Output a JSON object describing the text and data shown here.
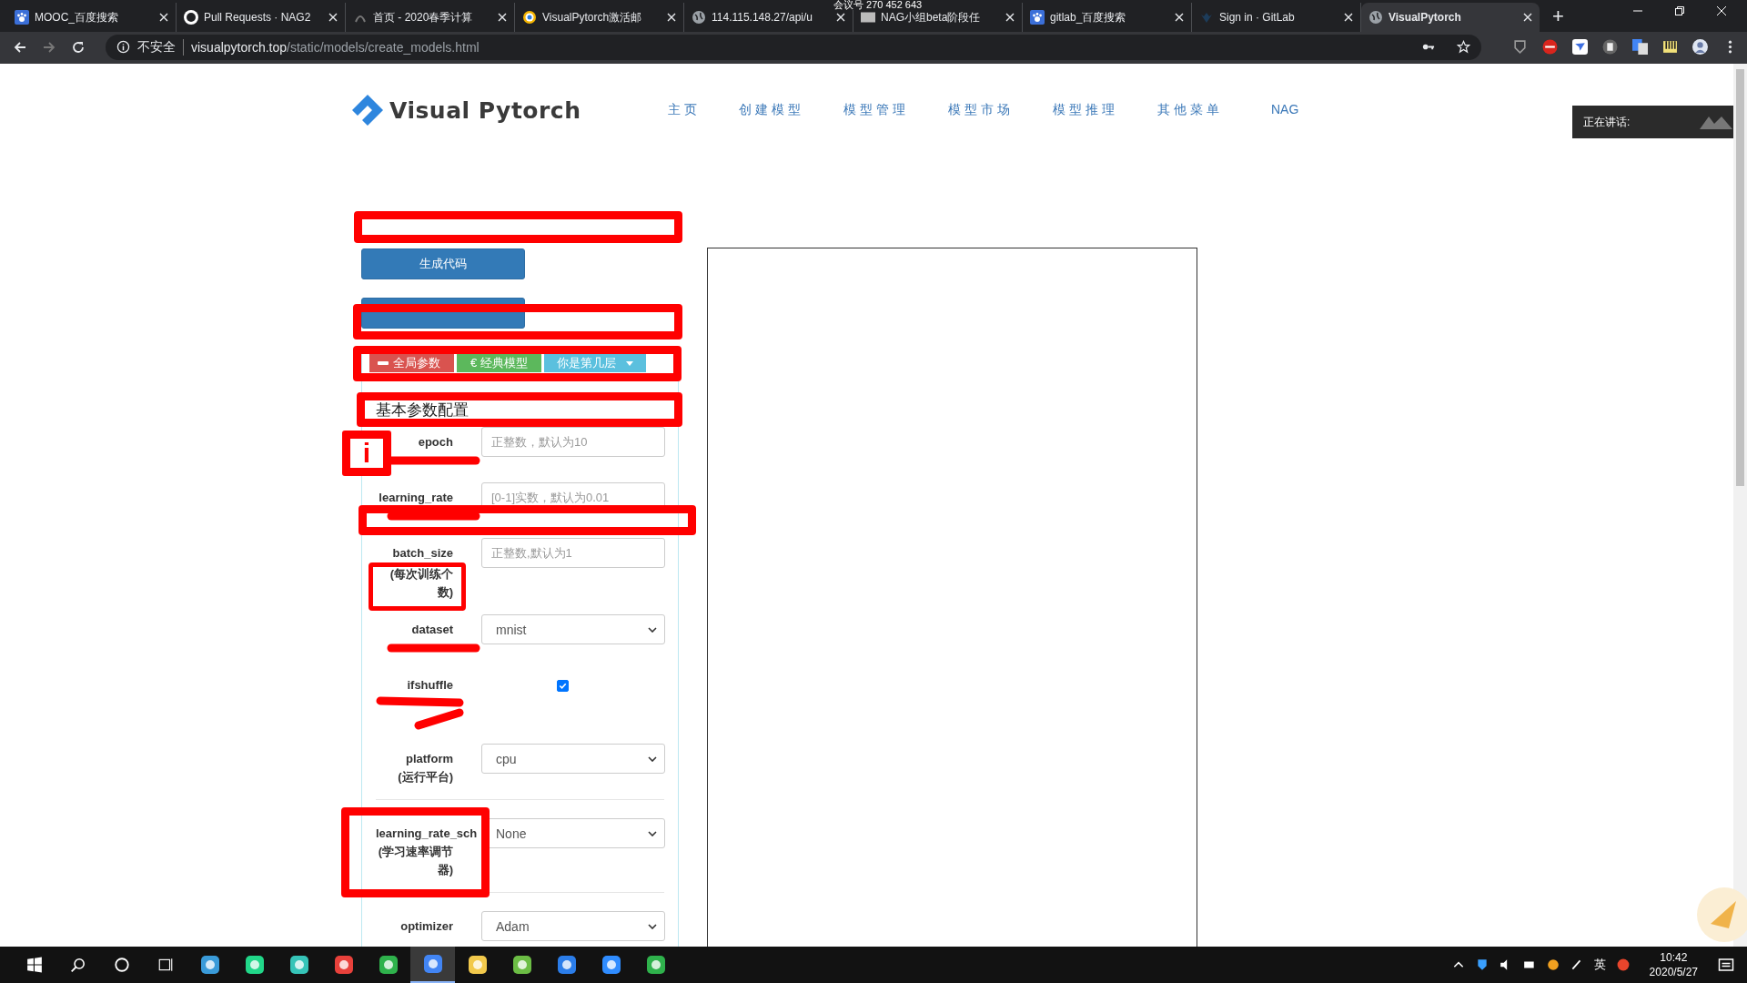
{
  "browser": {
    "tabs": [
      {
        "title": "MOOC_百度搜索",
        "selected": false
      },
      {
        "title": "Pull Requests · NAG2",
        "selected": false
      },
      {
        "title": "首页 - 2020春季计算",
        "selected": false
      },
      {
        "title": "VisualPytorch激活邮",
        "selected": false
      },
      {
        "title": "114.115.148.27/api/u",
        "selected": false
      },
      {
        "title": "NAG小组beta阶段任",
        "selected": false
      },
      {
        "title": "gitlab_百度搜索",
        "selected": false
      },
      {
        "title": "Sign in · GitLab",
        "selected": false
      },
      {
        "title": "VisualPytorch",
        "selected": true
      }
    ],
    "new_tab": "+",
    "meeting_badge": "会议号 270 452 643",
    "address": {
      "security": "不安全",
      "url": "**visualpytorch.top**/static/models/create_models.html"
    }
  },
  "navbar": {
    "brand": "Visual Pytorch",
    "items": [
      {
        "label": "主页"
      },
      {
        "label": "创建模型"
      },
      {
        "label": "模型管理"
      },
      {
        "label": "模型市场"
      },
      {
        "label": "模型推理"
      },
      {
        "label": "其他菜单"
      },
      {
        "label": "NAG"
      }
    ]
  },
  "speaking": {
    "label": "正在讲话:"
  },
  "form": {
    "buttons": [
      {
        "label": "生成代码",
        "boxed": false
      },
      {
        "boxed": true
      }
    ],
    "button_group": {
      "boxed": true,
      "items": [
        {
          "label": "全局参数",
          "color": "#d9534f",
          "kind": "minus"
        },
        {
          "label": "€ 经典模型",
          "color": "#5cb85c",
          "kind": "plain"
        },
        {
          "label": "你是第几层",
          "color": "#5bc0de",
          "kind": "dropdown"
        }
      ]
    },
    "heading": {
      "text": "基本参数配置",
      "boxed": true
    },
    "fields": [
      {
        "label": "epoch",
        "kind": "input",
        "placeholder": "正整数，默认为10",
        "scribbled": true,
        "info_mark": "i"
      },
      {
        "label": "learning_rate",
        "kind": "input",
        "placeholder": "[0-1]实数，默认为0.01",
        "scribbled": true,
        "row_boxed": true
      },
      {
        "label": "batch_size",
        "sublabel": "(每次训练个数)",
        "sublabel_boxed": true,
        "kind": "input",
        "placeholder": "正整数,默认为1"
      },
      {
        "label": "dataset",
        "kind": "select",
        "value": "mnist",
        "scribbled": true
      },
      {
        "label": "ifshuffle",
        "kind": "checkbox",
        "checked": true,
        "scribbled": true
      },
      {
        "label": "platform",
        "sublabel": "(运行平台)",
        "kind": "select",
        "value": "cpu"
      },
      {
        "label": "learning_rate_sch",
        "sublabel": "(学习速率调节器)",
        "label_boxed": true,
        "kind": "select",
        "value": "None",
        "divider_before": true
      },
      {
        "label": "optimizer",
        "kind": "select",
        "value": "Adam",
        "divider_before": true
      }
    ]
  },
  "taskbar": {
    "ime": "英",
    "time": "10:42",
    "date": "2020/5/27"
  }
}
